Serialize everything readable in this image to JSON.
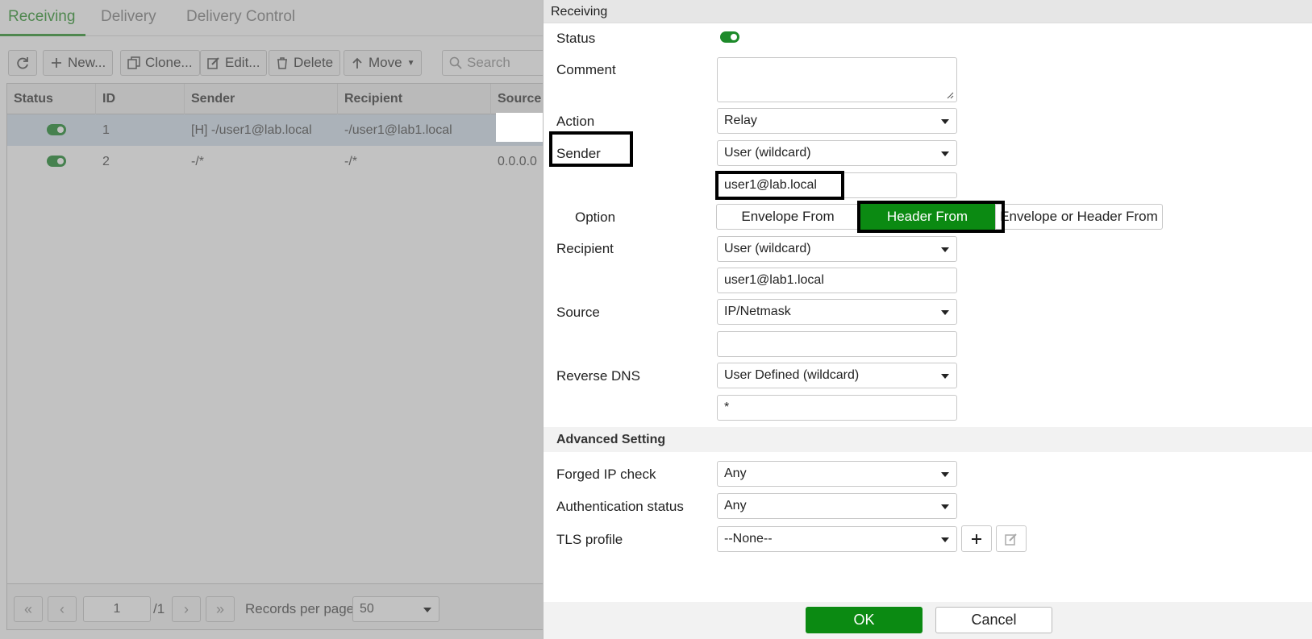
{
  "tabs": [
    "Receiving",
    "Delivery",
    "Delivery Control"
  ],
  "toolbar": {
    "new": "New...",
    "clone": "Clone...",
    "edit": "Edit...",
    "delete": "Delete",
    "move": "Move",
    "search_placeholder": "Search"
  },
  "grid": {
    "columns": [
      "Status",
      "ID",
      "Sender",
      "Recipient",
      "Source"
    ],
    "rows": [
      {
        "id": "1",
        "sender": "[H] -/user1@lab.local",
        "recipient": "-/user1@lab1.local",
        "source": ""
      },
      {
        "id": "2",
        "sender": "-/*",
        "recipient": "-/*",
        "source": "0.0.0.0"
      }
    ]
  },
  "pager": {
    "page": "1",
    "total": "/1",
    "records_label": "Records per page",
    "records_value": "50"
  },
  "dialog": {
    "title": "Receiving",
    "status_label": "Status",
    "comment_label": "Comment",
    "action_label": "Action",
    "action_value": "Relay",
    "sender_label": "Sender",
    "sender_type": "User (wildcard)",
    "sender_value": "user1@lab.local",
    "option_label": "Option",
    "options": [
      "Envelope From",
      "Header From",
      "Envelope or Header From"
    ],
    "recipient_label": "Recipient",
    "recipient_type": "User (wildcard)",
    "recipient_value": "user1@lab1.local",
    "source_label": "Source",
    "source_type": "IP/Netmask",
    "reverse_dns_label": "Reverse DNS",
    "reverse_dns_type": "User Defined (wildcard)",
    "reverse_dns_value": "*",
    "advanced_title": "Advanced Setting",
    "forged_ip_label": "Forged IP check",
    "forged_ip_value": "Any",
    "auth_status_label": "Authentication status",
    "auth_status_value": "Any",
    "tls_label": "TLS profile",
    "tls_value": "--None--",
    "ok": "OK",
    "cancel": "Cancel"
  },
  "colors": {
    "accent_green": "#0b8a12",
    "tab_green": "#3a9a3a"
  }
}
